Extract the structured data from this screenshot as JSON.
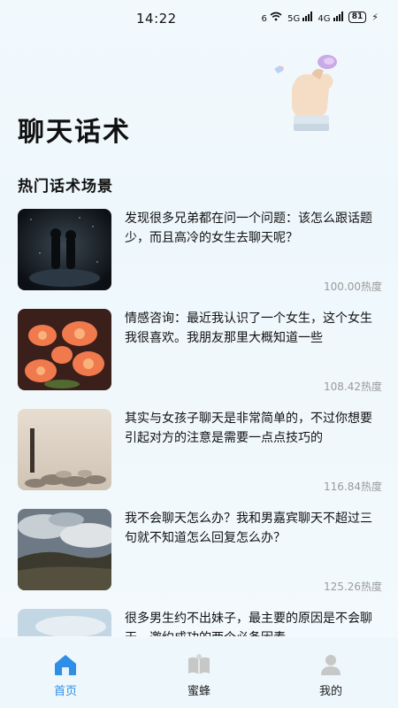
{
  "status": {
    "time": "14:22",
    "network_a": "6",
    "network_b": "5G",
    "network_c": "4G",
    "battery": "81"
  },
  "header": {
    "title": "聊天话术",
    "section_title": "热门话术场景"
  },
  "items": [
    {
      "text": "发现很多兄弟都在问一个问题：该怎么跟话题少，而且高冷的女生去聊天呢？",
      "heat": "100.00",
      "heat_suffix": "热度",
      "thumb": "dark-couple"
    },
    {
      "text": "情感咨询：最近我认识了一个女生，这个女生我很喜欢。我朋友那里大概知道一些",
      "heat": "108.42",
      "heat_suffix": "热度",
      "thumb": "orange-flowers"
    },
    {
      "text": "其实与女孩子聊天是非常简单的，不过你想要引起对方的注意是需要一点点技巧的",
      "heat": "116.84",
      "heat_suffix": "热度",
      "thumb": "beach-post"
    },
    {
      "text": "我不会聊天怎么办？我和男嘉宾聊天不超过三句就不知道怎么回复怎么办？",
      "heat": "125.26",
      "heat_suffix": "热度",
      "thumb": "cloudy-hills"
    },
    {
      "text": "很多男生约不出妹子，最主要的原因是不会聊天，邀约成功的两个必备因素",
      "heat": "",
      "heat_suffix": "",
      "thumb": "sky"
    }
  ],
  "nav": {
    "items": [
      {
        "label": "首页",
        "icon": "home-icon",
        "active": true
      },
      {
        "label": "蜜蜂",
        "icon": "book-icon",
        "active": false
      },
      {
        "label": "我的",
        "icon": "user-icon",
        "active": false
      }
    ],
    "active_color": "#2f8ee8"
  }
}
